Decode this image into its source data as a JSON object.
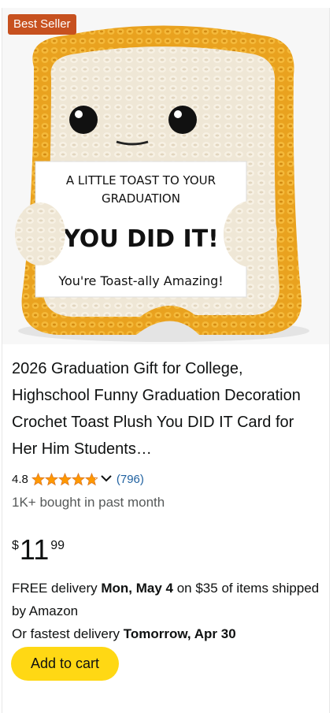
{
  "badge": "Best Seller",
  "product": {
    "image_alt": "Crochet toast plush holding card",
    "card_line1": "A LITTLE TOAST TO YOUR",
    "card_line2": "GRADUATION",
    "card_line3": "YOU DID IT!",
    "card_line4": "You're Toast-ally Amazing!",
    "title": "2026 Graduation Gift for College, Highschool Funny Graduation Decoration Crochet Toast Plush You DID IT Card for Her Him Students…"
  },
  "rating": {
    "value": "4.8",
    "stars": 4.8,
    "count": "(796)"
  },
  "bought": "1K+ bought in past month",
  "price": {
    "symbol": "$",
    "whole": "11",
    "fraction": "99"
  },
  "delivery": {
    "line1_prefix": "FREE delivery ",
    "line1_date": "Mon, May 4",
    "line1_suffix": " on $35 of items shipped by Amazon",
    "line2_prefix": "Or fastest delivery ",
    "line2_date": "Tomorrow, Apr 30"
  },
  "cart_button": "Add to cart",
  "colors": {
    "badge": "#c7511f",
    "star": "#ff9900",
    "link": "#2162a1",
    "button": "#ffd814"
  },
  "icons": {
    "rating_dropdown": "chevron-down-icon"
  }
}
